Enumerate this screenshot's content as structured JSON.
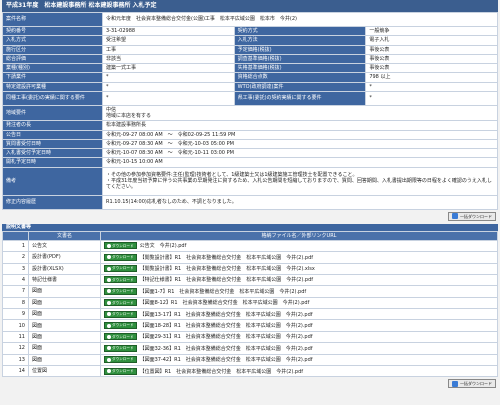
{
  "header": {
    "title": "平成31年度　松本建設事務所 松本建設事務所 入札予定"
  },
  "info": {
    "rows": [
      {
        "label": "案件名称",
        "value": "令和元年度　社会資本整備総合交付金(公園)工事　松本平広域公園　松本市　今井(2)",
        "label2": "",
        "value2": "",
        "cls": "tall1"
      },
      {
        "label": "契約番号",
        "value": "3-31-02988",
        "label2": "契約方式",
        "value2": "一般競争"
      },
      {
        "label": "入札方式",
        "value": "受注希望",
        "label2": "入札方法",
        "value2": "電子入札"
      },
      {
        "label": "施行区分",
        "value": "工事",
        "label2": "予定価格(税抜)",
        "value2": "事後公表"
      },
      {
        "label": "総合評価",
        "value": "非該当",
        "label2": "調査基準価格(税抜)",
        "value2": "事後公表"
      },
      {
        "label": "業種(種別)",
        "value": "建築一式工事",
        "label2": "失格基準価格(税抜)",
        "value2": "事後公表"
      },
      {
        "label": "下請業件",
        "value": "*",
        "label2": "資格総合点数",
        "value2": "798 以上"
      },
      {
        "label": "特定建設許可業種",
        "value": "*",
        "label2": "WTO(政府調達)案件",
        "value2": "*"
      },
      {
        "label": "同種工事(委託)の実績に関する要件",
        "value": "*",
        "label2": "県工事(委託)の契約実績に関する要件",
        "value2": "*",
        "cls": "tall1"
      },
      {
        "label": "地域要件",
        "value": "中信\n地域に本店を有する",
        "label2": "",
        "value2": "",
        "cls": "tall1"
      },
      {
        "label": "発注者の長",
        "value": "松本建設事務所長"
      },
      {
        "label": "公告日",
        "value": "令和元-09-27 08:00 AM　～　令和02-09-25 11:59 PM"
      },
      {
        "label": "質問書受付日時",
        "value": "令和元-09-27 08:30 AM　～　令和元-10-03 05:00 PM"
      },
      {
        "label": "入札書受付予定日時",
        "value": "令和元-10-07 08:30 AM　～　令和元-10-11 03:00 PM"
      },
      {
        "label": "開札予定日時",
        "value": "令和元-10-15 10:00 AM"
      },
      {
        "label": "備考",
        "value": "・その他の参加参加資格要件:主任(監理)技術者として、1級建築士又は1級建築施工管理技士を配置できること。\n・平成31年度当初予算に伴う公共事業の早期発注に資するため、入札公告期間を短縮しておりますので、質問、回答期間、入札書提出期限等の日程をよく確認のうえ入札してください。",
        "label2": "",
        "value2": "",
        "cls": "tall3"
      },
      {
        "label": "修正内容履歴",
        "value": "R1.10.15(14:00)応札者なしのため、不調となりました。",
        "cls": "tall1"
      }
    ]
  },
  "download_all": {
    "label": "一括ダウンロード"
  },
  "docs": {
    "title": "説明文書等",
    "col_name": "文書名",
    "col_file": "格納ファイル名／外部リンクURL",
    "dl_label": "ダウンロード",
    "items": [
      {
        "num": "1",
        "name": "公告文",
        "file": "公告文　今井(2).pdf"
      },
      {
        "num": "2",
        "name": "設計書(PDF)",
        "file": "【閲覧設計書】R1　社会資本整備総合交付金　松本平広域公園　今井(2).pdf"
      },
      {
        "num": "3",
        "name": "設計書(XLSX)",
        "file": "【閲覧設計書】R1　社会資本整備総合交付金　松本平広域公園　今井(2).xlsx"
      },
      {
        "num": "4",
        "name": "特記仕様書",
        "file": "【特記仕様書】R1　社会資本整備総合交付金　松本平広域公園　今井(2).pdf"
      },
      {
        "num": "7",
        "name": "図面",
        "file": "【図面1-7】R1　社会資本整備総合交付金　松本平広域公園　今井(2).pdf"
      },
      {
        "num": "8",
        "name": "図面",
        "file": "【図面8-12】R1　社会資本整備総合交付金　松本平広域公園　今井(2).pdf"
      },
      {
        "num": "9",
        "name": "図面",
        "file": "【図面13-17】R1　社会資本整備総合交付金　松本平広域公園　今井(2).pdf"
      },
      {
        "num": "10",
        "name": "図面",
        "file": "【図面18-28】R1　社会資本整備総合交付金　松本平広域公園　今井(2).pdf"
      },
      {
        "num": "11",
        "name": "図面",
        "file": "【図面29-31】R1　社会資本整備総合交付金　松本平広域公園　今井(2).pdf"
      },
      {
        "num": "12",
        "name": "図面",
        "file": "【図面32-36】R1　社会資本整備総合交付金　松本平広域公園　今井(2).pdf"
      },
      {
        "num": "13",
        "name": "図面",
        "file": "【図面37-42】R1　社会資本整備総合交付金　松本平広域公園　今井(2).pdf"
      },
      {
        "num": "14",
        "name": "位置図",
        "file": "【位置図】R1　社会資本整備総合交付金　松本平広域公園　今井(2).pdf"
      }
    ]
  }
}
